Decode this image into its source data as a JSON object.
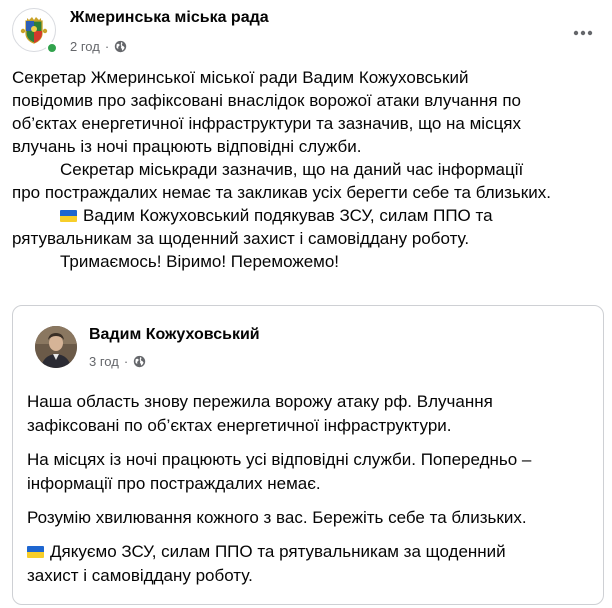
{
  "post": {
    "page_name": "Жмеринська міська рада",
    "time": "2 год",
    "separator": "·",
    "privacy_icon": "globe-icon",
    "more_icon": "more-horizontal-icon",
    "status": "online",
    "lines": [
      "Секретар Жмеринської міської ради Вадим Кожуховський",
      "повідомив про зафіксовані внаслідок ворожої атаки влучання по",
      "об’єктах енергетичної інфраструктури та зазначив, що на місцях",
      "влучань із ночі працюють відповідні  служби.",
      "Секретар міськради зазначив, що на даний час інформації",
      "про постраждалих немає та закликав усіх берегти себе та близьких.",
      "Вадим Кожуховський подякував  ЗСУ, силам ППО та",
      "рятувальникам за щоденний захист і самовіддану роботу.",
      "Тримаємось! Віримо! Переможемо!"
    ],
    "flag_icon": "ukraine-flag-icon"
  },
  "shared_post": {
    "author_name": "Вадим Кожуховський",
    "time": "3 год",
    "separator": "·",
    "privacy_icon": "globe-icon",
    "paragraphs": [
      [
        "Наша область знову пережила ворожу атаку рф. Влучання",
        "зафіксовані по об’єктах енергетичної інфраструктури."
      ],
      [
        "На місцях із ночі працюють усі відповідні служби. Попередньо –",
        "інформації про постраждалих немає."
      ],
      [
        "Розумію хвилювання кожного з вас. Бережіть себе та близьких."
      ],
      [
        "Дякуємо ЗСУ, силам ППО та рятувальникам за щоденний",
        "захист і самовіддану роботу."
      ]
    ]
  },
  "colors": {
    "text": "#050505",
    "meta": "#65676b",
    "online": "#31a24c",
    "card_border": "#ced0d4",
    "flag_blue": "#1e66d0",
    "flag_yellow": "#f7ce2a"
  }
}
